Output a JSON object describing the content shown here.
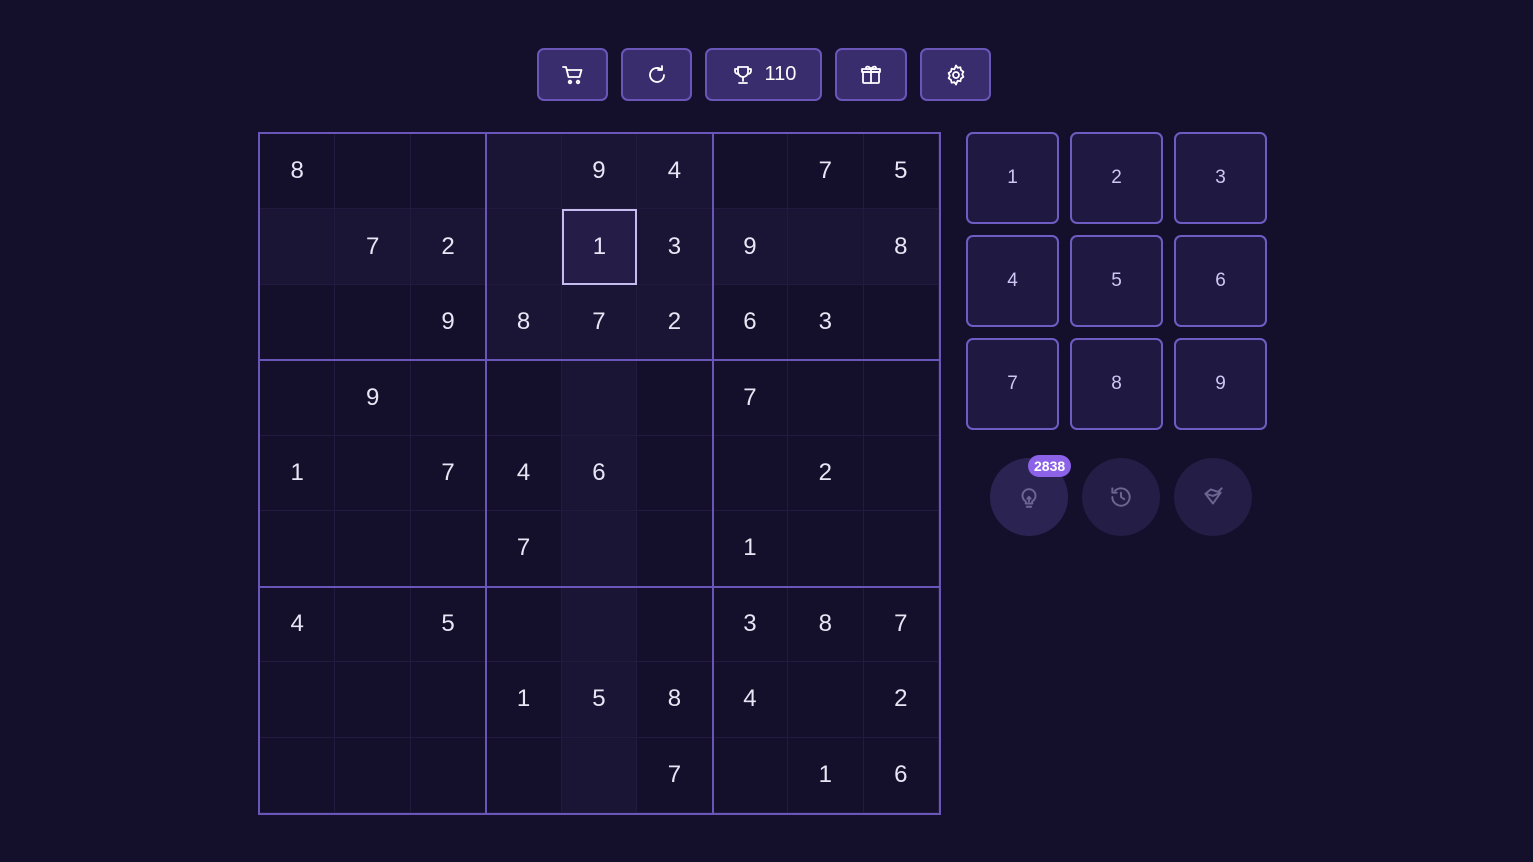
{
  "toolbar": {
    "trophy_count": "110",
    "icons": [
      "cart-icon",
      "reload-icon",
      "trophy-icon",
      "gift-icon",
      "gear-icon"
    ]
  },
  "board": {
    "rows": [
      [
        "8",
        "",
        "",
        "",
        "9",
        "4",
        "",
        "7",
        "5"
      ],
      [
        "",
        "7",
        "2",
        "",
        "1",
        "3",
        "9",
        "",
        "8"
      ],
      [
        "",
        "",
        "9",
        "8",
        "7",
        "2",
        "6",
        "3",
        ""
      ],
      [
        "",
        "9",
        "",
        "",
        "",
        "",
        "7",
        "",
        ""
      ],
      [
        "1",
        "",
        "7",
        "4",
        "6",
        "",
        "",
        "2",
        ""
      ],
      [
        "",
        "",
        "",
        "7",
        "",
        "",
        "1",
        "",
        ""
      ],
      [
        "4",
        "",
        "5",
        "",
        "",
        "",
        "3",
        "8",
        "7"
      ],
      [
        "",
        "",
        "",
        "1",
        "5",
        "8",
        "4",
        "",
        "2"
      ],
      [
        "",
        "",
        "",
        "",
        "",
        "7",
        "",
        "1",
        "6"
      ]
    ],
    "selected_cell": {
      "row": 1,
      "col": 4
    }
  },
  "numpad": [
    "1",
    "2",
    "3",
    "4",
    "5",
    "6",
    "7",
    "8",
    "9"
  ],
  "actions": {
    "hint_count": "2838",
    "icons": [
      "lightbulb-icon",
      "undo-icon",
      "eraser-icon"
    ]
  },
  "colors": {
    "background": "#140f2b",
    "accent": "#6a56b8",
    "badge": "#8b62e8"
  }
}
